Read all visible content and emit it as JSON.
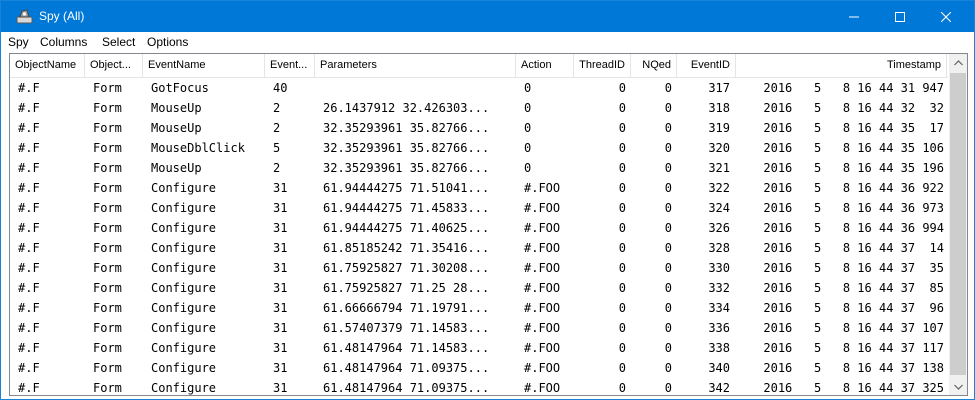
{
  "window": {
    "title": "Spy (All)",
    "icons": {
      "app": "spy-app-icon",
      "minimize": "minimize-icon",
      "maximize": "maximize-icon",
      "close": "close-icon"
    },
    "accent": "#0078d7"
  },
  "menu": {
    "items": [
      {
        "label": "Spy"
      },
      {
        "label": "Columns"
      },
      {
        "label": "Select"
      },
      {
        "label": "Options"
      }
    ]
  },
  "table": {
    "columns": [
      "ObjectName",
      "Object...",
      "EventName",
      "Event...",
      "Parameters",
      "Action",
      "ThreadID",
      "NQed",
      "EventID",
      "Timestamp"
    ],
    "rows": [
      [
        "#.F",
        "Form",
        "GotFocus",
        "40",
        "",
        "0",
        "0",
        "0",
        "317",
        "2016   5   8 16 44 31 947"
      ],
      [
        "#.F",
        "Form",
        "MouseUp",
        "2",
        "26.1437912 32.426303...",
        "0",
        "0",
        "0",
        "318",
        "2016   5   8 16 44 32  32"
      ],
      [
        "#.F",
        "Form",
        "MouseUp",
        "2",
        "32.35293961 35.82766...",
        "0",
        "0",
        "0",
        "319",
        "2016   5   8 16 44 35  17"
      ],
      [
        "#.F",
        "Form",
        "MouseDblClick",
        "5",
        "32.35293961 35.82766...",
        "0",
        "0",
        "0",
        "320",
        "2016   5   8 16 44 35 106"
      ],
      [
        "#.F",
        "Form",
        "MouseUp",
        "2",
        "32.35293961 35.82766...",
        "0",
        "0",
        "0",
        "321",
        "2016   5   8 16 44 35 196"
      ],
      [
        "#.F",
        "Form",
        "Configure",
        "31",
        "61.94444275 71.51041...",
        "#.FOO",
        "0",
        "0",
        "322",
        "2016   5   8 16 44 36 922"
      ],
      [
        "#.F",
        "Form",
        "Configure",
        "31",
        "61.94444275 71.45833...",
        "#.FOO",
        "0",
        "0",
        "324",
        "2016   5   8 16 44 36 973"
      ],
      [
        "#.F",
        "Form",
        "Configure",
        "31",
        "61.94444275 71.40625...",
        "#.FOO",
        "0",
        "0",
        "326",
        "2016   5   8 16 44 36 994"
      ],
      [
        "#.F",
        "Form",
        "Configure",
        "31",
        "61.85185242 71.35416...",
        "#.FOO",
        "0",
        "0",
        "328",
        "2016   5   8 16 44 37  14"
      ],
      [
        "#.F",
        "Form",
        "Configure",
        "31",
        "61.75925827 71.30208...",
        "#.FOO",
        "0",
        "0",
        "330",
        "2016   5   8 16 44 37  35"
      ],
      [
        "#.F",
        "Form",
        "Configure",
        "31",
        "61.75925827 71.25 28...",
        "#.FOO",
        "0",
        "0",
        "332",
        "2016   5   8 16 44 37  85"
      ],
      [
        "#.F",
        "Form",
        "Configure",
        "31",
        "61.66666794 71.19791...",
        "#.FOO",
        "0",
        "0",
        "334",
        "2016   5   8 16 44 37  96"
      ],
      [
        "#.F",
        "Form",
        "Configure",
        "31",
        "61.57407379 71.14583...",
        "#.FOO",
        "0",
        "0",
        "336",
        "2016   5   8 16 44 37 107"
      ],
      [
        "#.F",
        "Form",
        "Configure",
        "31",
        "61.48147964 71.14583...",
        "#.FOO",
        "0",
        "0",
        "338",
        "2016   5   8 16 44 37 117"
      ],
      [
        "#.F",
        "Form",
        "Configure",
        "31",
        "61.48147964 71.09375...",
        "#.FOO",
        "0",
        "0",
        "340",
        "2016   5   8 16 44 37 138"
      ],
      [
        "#.F",
        "Form",
        "Configure",
        "31",
        "61.48147964 71.09375...",
        "#.FOO",
        "0",
        "0",
        "342",
        "2016   5   8 16 44 37 325"
      ]
    ]
  },
  "scrollbar": {
    "up_icon": "scroll-up-arrow-icon",
    "down_icon": "scroll-down-arrow-icon"
  }
}
